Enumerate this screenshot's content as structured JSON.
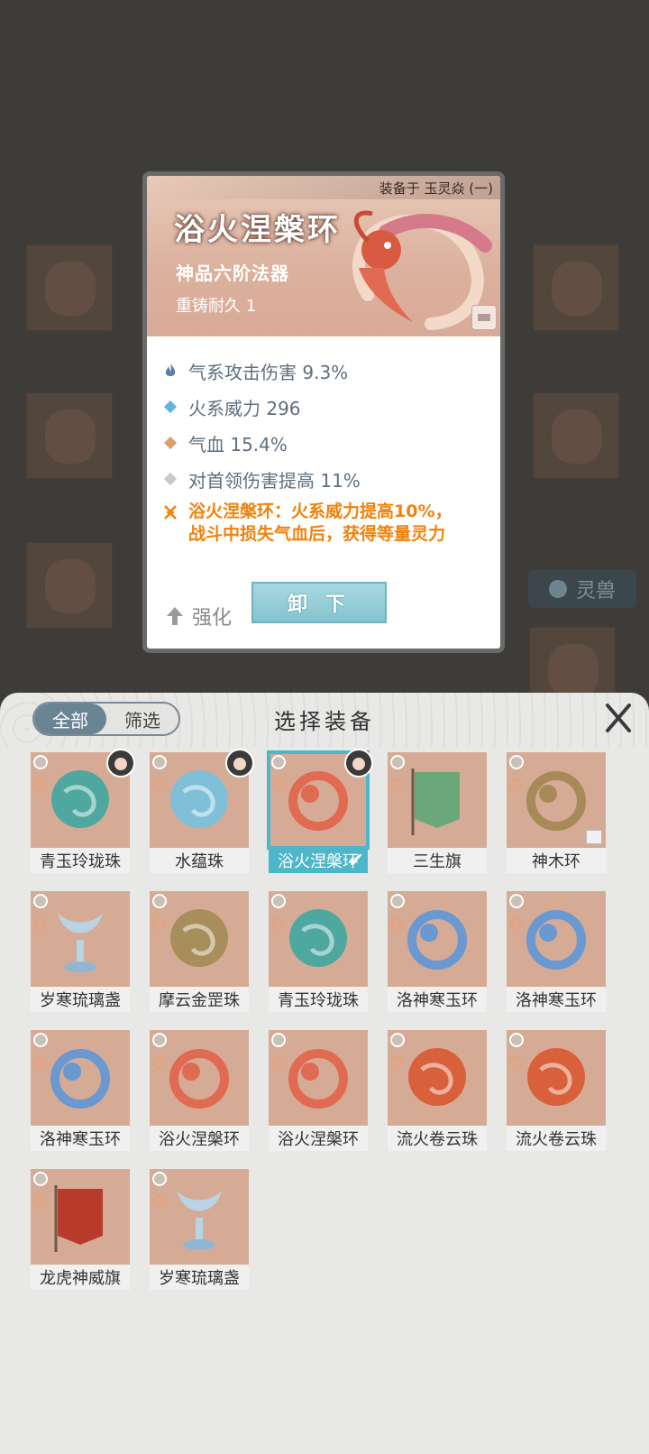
{
  "detail_card": {
    "equipped_on": "装备于 玉灵焱 (一)",
    "name": "浴火涅槃环",
    "grade": "神品六阶法器",
    "durability": "重铸耐久 1",
    "stats": [
      {
        "text": "气系攻击伤害 9.3%",
        "icon": "flame-icon",
        "color": "#5d7fa3"
      },
      {
        "text": "火系威力 296",
        "icon": "diamond-icon",
        "color": "#5fb6d8"
      },
      {
        "text": "气血 15.4%",
        "icon": "diamond-icon",
        "color": "#d9a06a"
      },
      {
        "text": "对首领伤害提高 11%",
        "icon": "diamond-icon",
        "color": "#c8c8c8"
      }
    ],
    "special_line1": "浴火涅槃环：火系威力提高10%，",
    "special_line2": "战斗中损失气血后，获得等量灵力",
    "strengthen_label": "强化",
    "unequip_label": "卸 下"
  },
  "background": {
    "tab_label": "灵兽"
  },
  "panel": {
    "filter_all": "全部",
    "filter_screen": "筛选",
    "title": "选择装备",
    "close_label": "X"
  },
  "items": [
    {
      "name": "青玉玲珑珠",
      "art": "jade-orb",
      "color": "#4fa8a0",
      "avatar": true
    },
    {
      "name": "水蕴珠",
      "art": "water-orb",
      "color": "#7fc0d8",
      "avatar": true
    },
    {
      "name": "浴火涅槃环",
      "art": "phoenix-ring",
      "color": "#e06a52",
      "avatar": true,
      "selected": true
    },
    {
      "name": "三生旗",
      "art": "banner",
      "color": "#6aa87a"
    },
    {
      "name": "神木环",
      "art": "wood-ring",
      "color": "#a88a58",
      "lock": true
    },
    {
      "name": "岁寒琉璃盏",
      "art": "ice-cup",
      "color": "#b8d4e6"
    },
    {
      "name": "摩云金罡珠",
      "art": "gold-orb",
      "color": "#a88e5a"
    },
    {
      "name": "青玉玲珑珠",
      "art": "jade-orb",
      "color": "#4fa8a0"
    },
    {
      "name": "洛神寒玉环",
      "art": "ice-ring",
      "color": "#6a98d0"
    },
    {
      "name": "洛神寒玉环",
      "art": "ice-ring",
      "color": "#6a98d0"
    },
    {
      "name": "洛神寒玉环",
      "art": "ice-ring",
      "color": "#6a98d0"
    },
    {
      "name": "浴火涅槃环",
      "art": "phoenix-ring",
      "color": "#e06a52"
    },
    {
      "name": "浴火涅槃环",
      "art": "phoenix-ring",
      "color": "#e06a52"
    },
    {
      "name": "流火卷云珠",
      "art": "fire-orb",
      "color": "#d8603a"
    },
    {
      "name": "流火卷云珠",
      "art": "fire-orb",
      "color": "#d8603a"
    },
    {
      "name": "龙虎神威旗",
      "art": "dragon-banner",
      "color": "#b83a2a"
    },
    {
      "name": "岁寒琉璃盏",
      "art": "ice-cup",
      "color": "#b8d4e6"
    }
  ]
}
